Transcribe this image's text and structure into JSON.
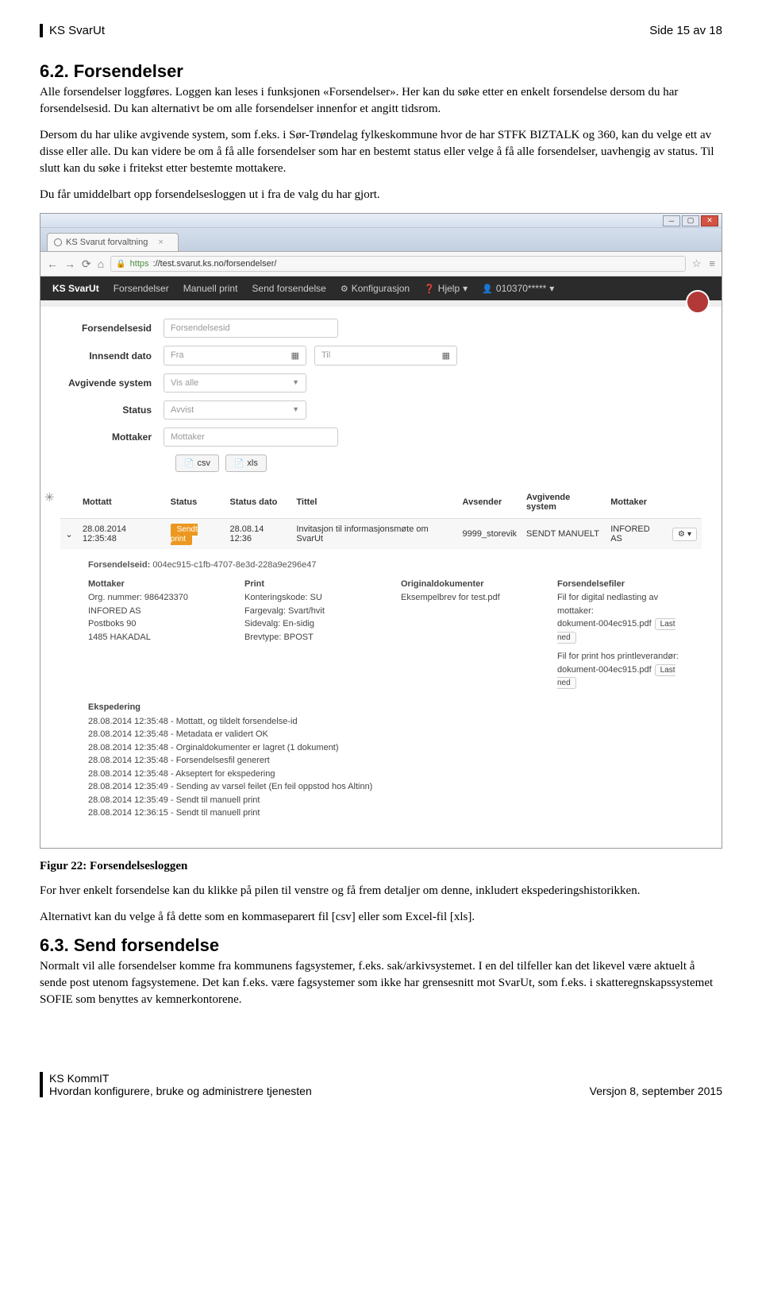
{
  "header": {
    "left": "KS SvarUt",
    "right": "Side 15 av 18"
  },
  "section1": {
    "number": "6.2.",
    "title": "Forsendelser",
    "p1": "Alle forsendelser loggføres. Loggen kan leses i funksjonen «Forsendelser». Her kan du søke etter en enkelt forsendelse dersom du har forsendelsesid. Du kan alternativt be om alle forsendelser innenfor et angitt tidsrom.",
    "p2": "Dersom du har ulike avgivende system, som f.eks. i Sør-Trøndelag fylkeskommune hvor de har STFK BIZTALK og 360, kan du velge ett av disse eller alle. Du kan videre be om å få alle forsendelser som har en bestemt status eller velge å få alle forsendelser, uavhengig av status. Til slutt kan du søke i fritekst etter bestemte mottakere.",
    "p3": "Du får umiddelbart opp forsendelsesloggen ut i fra de valg du har gjort."
  },
  "browser": {
    "tab_title": "KS Svarut forvaltning",
    "url_https": "https",
    "url_rest": "://test.svarut.ks.no/forsendelser/"
  },
  "app_nav": {
    "brand": "KS SvarUt",
    "items": [
      "Forsendelser",
      "Manuell print",
      "Send forsendelse"
    ],
    "config": "Konfigurasjon",
    "help": "Hjelp",
    "user": "010370*****"
  },
  "filters": {
    "labels": {
      "id": "Forsendelsesid",
      "dato": "Innsendt dato",
      "system": "Avgivende system",
      "status": "Status",
      "mottaker": "Mottaker"
    },
    "placeholders": {
      "id": "Forsendelsesid",
      "fra": "Fra",
      "til": "Til",
      "system": "Vis alle",
      "status": "Avvist",
      "mottaker": "Mottaker"
    },
    "export_csv": "csv",
    "export_xls": "xls"
  },
  "table": {
    "heads": [
      "Mottatt",
      "Status",
      "Status dato",
      "Tittel",
      "Avsender",
      "Avgivende system",
      "Mottaker"
    ],
    "row": {
      "mottatt": "28.08.2014 12:35:48",
      "status": "Sendt print",
      "status_dato": "28.08.14 12:36",
      "tittel": "Invitasjon til informasjonsmøte om SvarUt",
      "avsender": "9999_storevik",
      "system": "SENDT MANUELT",
      "mottaker": "INFORED AS"
    }
  },
  "detail": {
    "fid_label": "Forsendelseid:",
    "fid": "004ec915-c1fb-4707-8e3d-228a9e296e47",
    "mottaker": {
      "head": "Mottaker",
      "org_label": "Org. nummer: 986423370",
      "name": "INFORED AS",
      "addr1": "Postboks 90",
      "addr2": "1485 HAKADAL"
    },
    "print": {
      "head": "Print",
      "l1": "Konteringskode: SU",
      "l2": "Fargevalg: Svart/hvit",
      "l3": "Sidevalg: En-sidig",
      "l4": "Brevtype: BPOST"
    },
    "orig": {
      "head": "Originaldokumenter",
      "l1": "Eksempelbrev for test.pdf"
    },
    "filer": {
      "head": "Forsendelsefiler",
      "l1": "Fil for digital nedlasting av mottaker:",
      "f1": "dokument-004ec915.pdf",
      "l2": "Fil for print hos printleverandør:",
      "f2": "dokument-004ec915.pdf",
      "btn": "Last ned"
    },
    "eksp": {
      "head": "Ekspedering",
      "items": [
        "28.08.2014 12:35:48 - Mottatt, og tildelt forsendelse-id",
        "28.08.2014 12:35:48 - Metadata er validert OK",
        "28.08.2014 12:35:48 - Orginaldokumenter er lagret (1 dokument)",
        "28.08.2014 12:35:48 - Forsendelsesfil generert",
        "28.08.2014 12:35:48 - Akseptert for ekspedering",
        "28.08.2014 12:35:49 - Sending av varsel feilet (En feil oppstod hos Altinn)",
        "28.08.2014 12:35:49 - Sendt til manuell print",
        "28.08.2014 12:36:15 - Sendt til manuell print"
      ]
    }
  },
  "caption": "Figur 22: Forsendelsesloggen",
  "after": {
    "p1": "For hver enkelt forsendelse kan du klikke på pilen til venstre og få frem detaljer om denne, inkludert ekspederingshistorikken.",
    "p2": "Alternativt kan du velge å få dette som en kommaseparert fil [csv] eller som Excel-fil [xls]."
  },
  "section2": {
    "number": "6.3.",
    "title": "Send forsendelse",
    "p1": "Normalt vil alle forsendelser komme fra kommunens fagsystemer, f.eks. sak/arkivsystemet. I en del tilfeller kan det likevel være aktuelt å sende post utenom fagsystemene. Det kan f.eks. være fagsystemer som ikke har grensesnitt mot SvarUt, som f.eks. i skatteregnskapssystemet SOFIE som benyttes av kemnerkontorene."
  },
  "footer": {
    "l1": "KS KommIT",
    "l2": "Hvordan konfigurere, bruke og administrere tjenesten",
    "right": "Versjon 8, september 2015"
  }
}
